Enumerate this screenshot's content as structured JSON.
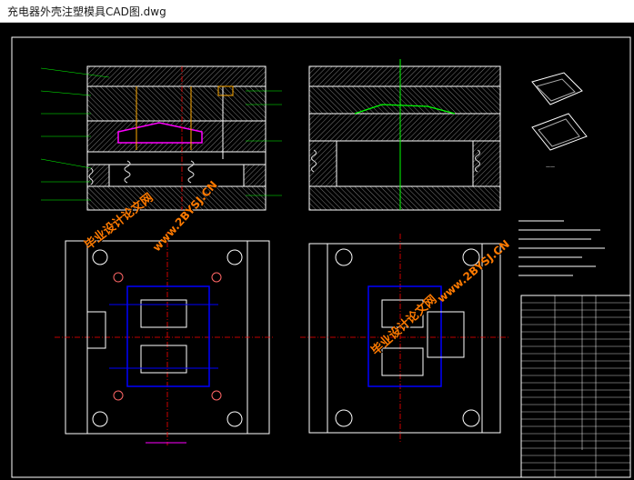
{
  "window": {
    "title": "充电器外壳注塑模具CAD图.dwg"
  },
  "watermarks": {
    "cn_left": "毕业设计论文网",
    "url_left": "www.2BYSJ.CN",
    "cn_right": "毕业设计论文网",
    "url_right": "www.2BYSJ.CN"
  },
  "colors": {
    "background": "#000000",
    "outline": "#ffffff",
    "hatch": "#bfbfbf",
    "cavity": "#ff00ff",
    "cooling": "#0000ff",
    "center": "#ff0000",
    "leader": "#00ff00",
    "spring": "#dddddd",
    "watermark": "#ff7a00"
  },
  "icons": [
    "drawing-canvas",
    "section-view",
    "plan-view",
    "iso-view",
    "title-block"
  ]
}
